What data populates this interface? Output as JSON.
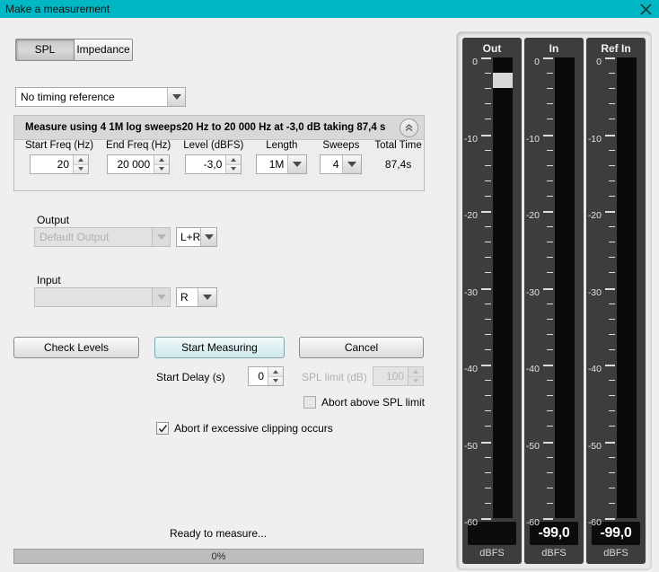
{
  "window": {
    "title": "Make a measurement",
    "titlebar_color": "#00b7c3",
    "close_icon": "close-icon"
  },
  "tabs": [
    {
      "label": "SPL",
      "active": true
    },
    {
      "label": "Impedance",
      "active": false
    }
  ],
  "timing_reference": {
    "value": "No timing reference",
    "arrow_icon": "chevron-down-icon"
  },
  "measure_group": {
    "header": "Measure using 4 1M log sweeps20 Hz to 20 000 Hz at -3,0 dB taking 87,4 s",
    "collapse_icon": "double-chevron-up-icon",
    "fields": [
      {
        "label": "Start Freq (Hz)",
        "value": "20",
        "type": "spinner",
        "width": 66
      },
      {
        "label": "End Freq (Hz)",
        "value": "20 000",
        "type": "spinner",
        "width": 70
      },
      {
        "label": "Level (dBFS)",
        "value": "-3,0",
        "type": "spinner",
        "width": 63
      },
      {
        "label": "Length",
        "value": "1M",
        "type": "combo",
        "width": 57
      },
      {
        "label": "Sweeps",
        "value": "4",
        "type": "combo",
        "width": 47
      },
      {
        "label": "Total Time",
        "value": "87,4s",
        "type": "text",
        "width": 62
      }
    ]
  },
  "output": {
    "label": "Output",
    "device": "Default Output",
    "device_disabled": true,
    "channel": "L+R"
  },
  "input": {
    "label": "Input",
    "device": "",
    "device_disabled": true,
    "channel": "R"
  },
  "buttons": {
    "check_levels": "Check Levels",
    "start_measuring": "Start Measuring",
    "cancel": "Cancel"
  },
  "start_delay": {
    "label": "Start Delay (s)",
    "value": "0"
  },
  "spl_limit": {
    "label": "SPL limit (dB)",
    "value": "100",
    "disabled": true
  },
  "checkboxes": {
    "abort_spl": {
      "label": "Abort above SPL limit",
      "checked": false
    },
    "abort_clipping": {
      "label": "Abort if excessive clipping occurs",
      "checked": true
    }
  },
  "status": {
    "text": "Ready to measure...",
    "progress_label": "0%",
    "progress_percent": 0
  },
  "meters": {
    "scale": {
      "max_db": 0,
      "min_db": -60,
      "major_labels": [
        "0",
        "-10",
        "-20",
        "-30",
        "-40",
        "-50",
        "-60"
      ],
      "major_values": [
        0,
        -10,
        -20,
        -30,
        -40,
        -50,
        -60
      ],
      "minor_step_db": 2
    },
    "unit": "dBFS",
    "channels": [
      {
        "name": "Out",
        "readout": "",
        "has_readout": false,
        "peak_db": -2,
        "peak_height_db": 2
      },
      {
        "name": "In",
        "readout": "-99,0",
        "has_readout": true,
        "peak_db": null,
        "peak_height_db": 0
      },
      {
        "name": "Ref In",
        "readout": "-99,0",
        "has_readout": true,
        "peak_db": null,
        "peak_height_db": 0
      }
    ]
  }
}
